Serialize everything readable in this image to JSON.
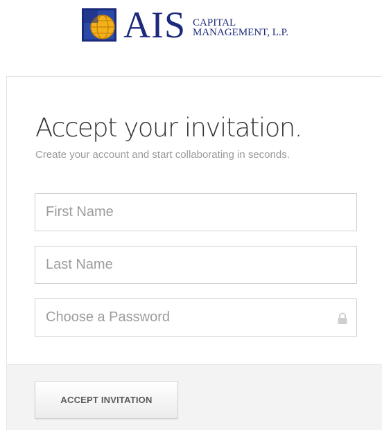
{
  "logo": {
    "mark_text": "AIS",
    "line1": "CAPITAL",
    "line2": "MANAGEMENT, L.P.",
    "icon": "globe-emblem-icon",
    "colors": {
      "navy": "#1b2a7a",
      "gold": "#e8a20f"
    }
  },
  "form": {
    "heading": "Accept your invitation.",
    "subheading": "Create your account and start collaborating in seconds.",
    "first_name": {
      "placeholder": "First Name",
      "value": ""
    },
    "last_name": {
      "placeholder": "Last Name",
      "value": ""
    },
    "password": {
      "placeholder": "Choose a Password",
      "value": "",
      "icon": "lock-icon"
    },
    "submit_label": "ACCEPT INVITATION"
  }
}
